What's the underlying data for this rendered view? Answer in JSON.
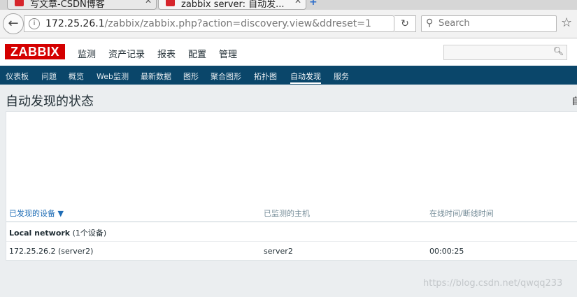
{
  "browser": {
    "tabs": [
      {
        "title": "写文章-CSDN博客"
      },
      {
        "title": "zabbix server: 自动发..."
      }
    ],
    "url_host": "172.25.26.1",
    "url_path": "/zabbix/zabbix.php?action=discovery.view&ddreset=1",
    "search_placeholder": "Search"
  },
  "app": {
    "logo": "ZABBIX",
    "main_menu": [
      "监测",
      "资产记录",
      "报表",
      "配置",
      "管理"
    ],
    "active_main": "监测",
    "sub_menu": [
      "仪表板",
      "问题",
      "概览",
      "Web监测",
      "最新数据",
      "图形",
      "聚合图形",
      "拓扑图",
      "自动发现",
      "服务"
    ],
    "active_sub": "自动发现"
  },
  "page": {
    "title": "自动发现的状态",
    "right_glyph": "自"
  },
  "table": {
    "headers": [
      "已发现的设备 ▼",
      "已监测的主机",
      "在线时间/断线时间"
    ],
    "group": {
      "name": "Local network",
      "count": "(1个设备)"
    },
    "rows": [
      {
        "device": "172.25.26.2 (server2)",
        "host": "server2",
        "uptime": "00:00:25"
      }
    ]
  },
  "watermark": "https://blog.csdn.net/qwqq233",
  "colors": {
    "brand": "#d40000",
    "subnav": "#0a466a",
    "link": "#1f6db6"
  }
}
